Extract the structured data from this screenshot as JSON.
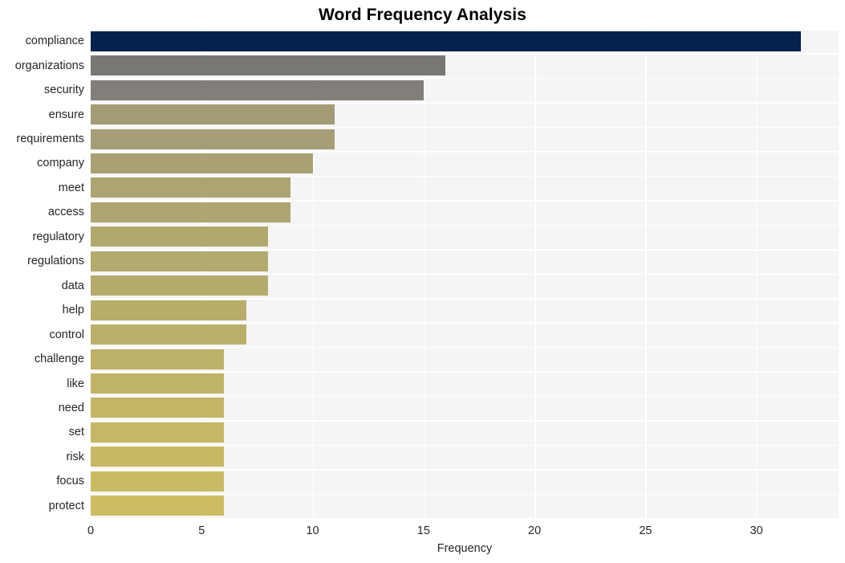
{
  "chart_data": {
    "type": "bar",
    "orientation": "horizontal",
    "title": "Word Frequency Analysis",
    "xlabel": "Frequency",
    "ylabel": "",
    "categories": [
      "compliance",
      "organizations",
      "security",
      "ensure",
      "requirements",
      "company",
      "meet",
      "access",
      "regulatory",
      "regulations",
      "data",
      "help",
      "control",
      "challenge",
      "like",
      "need",
      "set",
      "risk",
      "focus",
      "protect"
    ],
    "values": [
      32,
      16,
      15,
      11,
      11,
      10,
      9,
      9,
      8,
      8,
      8,
      7,
      7,
      6,
      6,
      6,
      6,
      6,
      6,
      6
    ],
    "bar_colors": [
      "#04224c",
      "#797774",
      "#827f7b",
      "#a39b76",
      "#a59d76",
      "#a9a073",
      "#aca471",
      "#aea570",
      "#b1a86e",
      "#b3aa6d",
      "#b5ab6c",
      "#b8ad6b",
      "#baaf6a",
      "#bdb168",
      "#bfb367",
      "#c2b566",
      "#c4b765",
      "#c7b964",
      "#c9bb63",
      "#ccbd62"
    ],
    "xlim": [
      0,
      33.7
    ],
    "xticks": [
      0,
      5,
      10,
      15,
      20,
      25,
      30
    ],
    "xtick_labels": [
      "0",
      "5",
      "10",
      "15",
      "20",
      "25",
      "30"
    ],
    "grid": true,
    "grid_color": "#ffffff",
    "plot_background": "#f5f5f6",
    "figure_background": "#ffffff",
    "legend": null,
    "title_color": "#000000",
    "tick_label_color": "#262626"
  }
}
